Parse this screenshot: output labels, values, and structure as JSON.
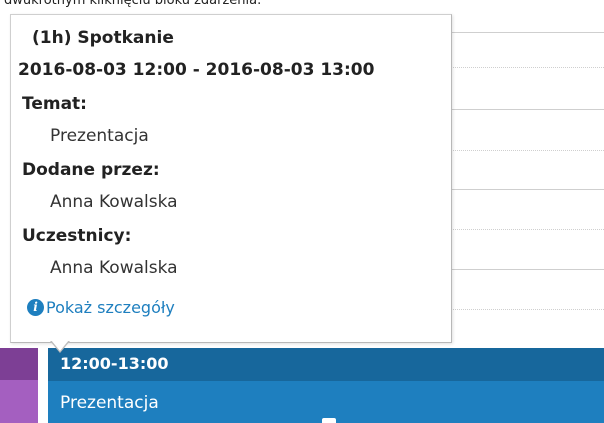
{
  "caption": "dwukrotnym kliknięciu bloku zdarzenia.",
  "popup": {
    "title": "(1h) Spotkanie",
    "date_range": "2016-08-03 12:00 - 2016-08-03 13:00",
    "topic_label": "Temat:",
    "topic_value": "Prezentacja",
    "added_by_label": "Dodane przez:",
    "added_by_value": "Anna Kowalska",
    "participants_label": "Uczestnicy:",
    "participants_value": "Anna Kowalska",
    "details_link": "Pokaż szczegóły",
    "info_icon": "i"
  },
  "event": {
    "time": "12:00-13:00",
    "title": "Prezentacja"
  },
  "colors": {
    "event_header": "#17679c",
    "event_body": "#1e7fbf",
    "link": "#1e7fbf",
    "category_strip": "#9a52b0"
  }
}
